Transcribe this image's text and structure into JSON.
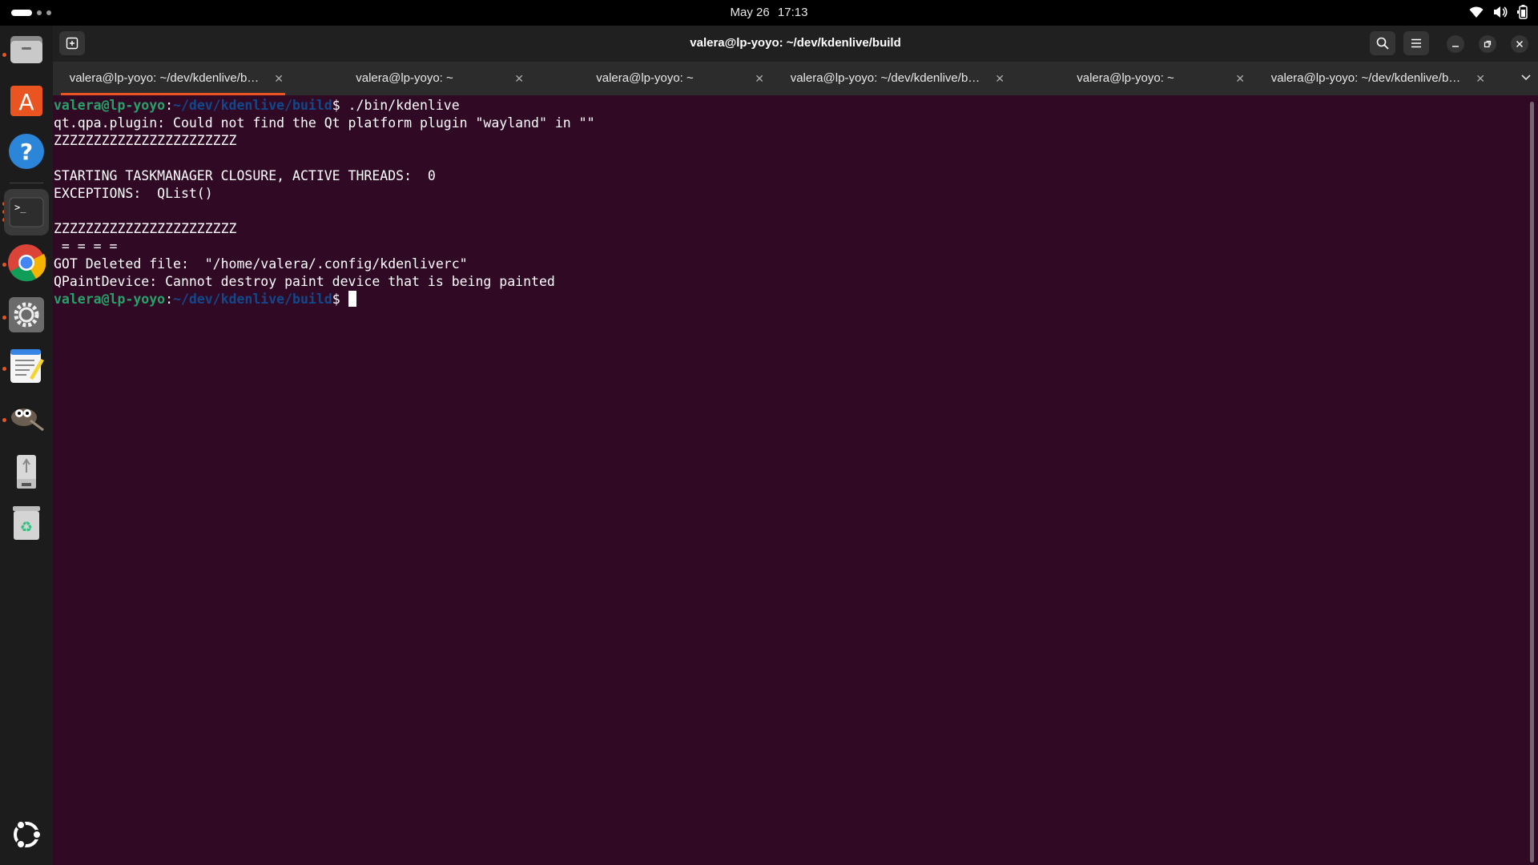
{
  "topbar": {
    "date": "May 26",
    "time": "17:13",
    "icons": [
      "wifi-icon",
      "volume-icon",
      "battery-icon"
    ]
  },
  "dock": {
    "items": [
      "files-icon",
      "app-center-icon",
      "help-icon",
      "terminal-icon",
      "chrome-icon",
      "settings-icon",
      "text-editor-icon",
      "gimp-icon",
      "usb-drive-icon",
      "trash-icon",
      "show-apps-icon"
    ]
  },
  "window": {
    "title": "valera@lp-yoyo: ~/dev/kdenlive/build"
  },
  "tabs": [
    {
      "label": "valera@lp-yoyo: ~/dev/kdenlive/b…",
      "active": true
    },
    {
      "label": "valera@lp-yoyo: ~",
      "active": false
    },
    {
      "label": "valera@lp-yoyo: ~",
      "active": false
    },
    {
      "label": "valera@lp-yoyo: ~/dev/kdenlive/b…",
      "active": false
    },
    {
      "label": "valera@lp-yoyo: ~",
      "active": false
    },
    {
      "label": "valera@lp-yoyo: ~/dev/kdenlive/b…",
      "active": false
    }
  ],
  "terminal": {
    "prompt_user": "valera@lp-yoyo",
    "prompt_sep": ":",
    "prompt_path": "~/dev/kdenlive/build",
    "prompt_dollar": "$",
    "command": " ./bin/kdenlive",
    "output": [
      "qt.qpa.plugin: Could not find the Qt platform plugin \"wayland\" in \"\"",
      "ZZZZZZZZZZZZZZZZZZZZZZZ",
      "",
      "STARTING TASKMANAGER CLOSURE, ACTIVE THREADS:  0",
      "EXCEPTIONS:  QList()",
      "",
      "ZZZZZZZZZZZZZZZZZZZZZZZ",
      " = = = =",
      "GOT Deleted file:  \"/home/valera/.config/kdenliverc\"",
      "QPaintDevice: Cannot destroy paint device that is being painted"
    ]
  }
}
